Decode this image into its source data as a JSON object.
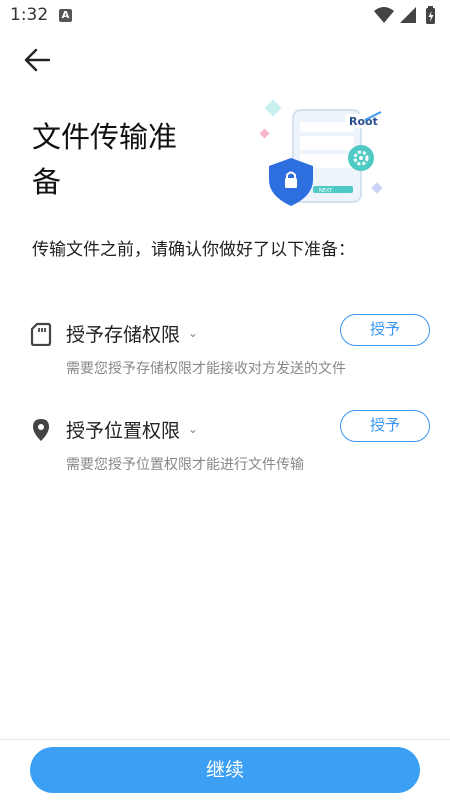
{
  "status_bar": {
    "time": "1:32",
    "notification_badge": "A",
    "icons": [
      "wifi-icon",
      "signal-icon",
      "battery-charging-icon"
    ]
  },
  "header": {
    "back_icon": "arrow-left-icon",
    "title": "文件传输准备"
  },
  "hero": {
    "badge_text": "Root",
    "next_text": "NEXT",
    "icons": [
      "lock-shield-icon",
      "gear-icon"
    ]
  },
  "intro_text": "传输文件之前，请确认你做好了以下准备：",
  "permissions": [
    {
      "icon": "sd-card-icon",
      "title": "授予存储权限",
      "description": "需要您授予存储权限才能接收对方发送的文件",
      "button_label": "授予"
    },
    {
      "icon": "location-pin-icon",
      "title": "授予位置权限",
      "description": "需要您授予位置权限才能进行文件传输",
      "button_label": "授予"
    }
  ],
  "footer": {
    "continue_label": "继续"
  },
  "colors": {
    "accent": "#3b97f0",
    "button_fill": "#3ba0f3",
    "shield": "#2e6fe0",
    "gear_badge": "#4fc9c4"
  }
}
